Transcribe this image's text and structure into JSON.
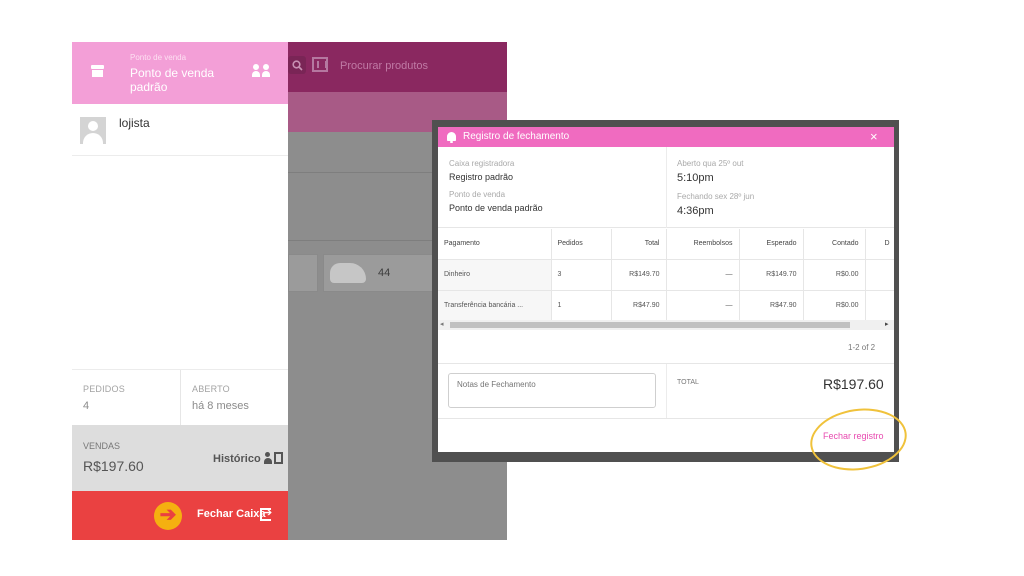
{
  "app": {
    "search_placeholder": "Procurar produtos",
    "product_size": "44"
  },
  "sidebar": {
    "pos_label": "Ponto de venda",
    "pos_name": "Ponto de venda padrão",
    "user_name": "lojista",
    "stats": {
      "orders_label": "PEDIDOS",
      "orders_value": "4",
      "open_label": "ABERTO",
      "open_value": "há 8 meses"
    },
    "sales_label": "VENDAS",
    "sales_value": "R$197.60",
    "history_label": "Histórico",
    "close_cash_label": "Fechar Caixa",
    "header_color": "#f39fd7",
    "close_color": "#ea4141"
  },
  "modal": {
    "title": "Registro de fechamento",
    "close_symbol": "×",
    "register_label": "Caixa registradora",
    "register_value": "Registro padrão",
    "pos_label": "Ponto de venda",
    "pos_value": "Ponto de venda padrão",
    "opened_label": "Aberto qua 25º out",
    "opened_time": "5:10pm",
    "closed_label": "Fechando sex 28º jun",
    "closed_time": "4:36pm",
    "table": {
      "headers": [
        "Pagamento",
        "Pedidos",
        "Total",
        "Reembolsos",
        "Esperado",
        "Contado",
        "D"
      ],
      "rows": [
        [
          "Dinheiro",
          "3",
          "R$149.70",
          "—",
          "R$149.70",
          "R$0.00",
          ""
        ],
        [
          "Transferência bancária ...",
          "1",
          "R$47.90",
          "—",
          "R$47.90",
          "R$0.00",
          ""
        ]
      ]
    },
    "pagination": "1-2 of 2",
    "notes_placeholder": "Notas de Fechamento",
    "total_label": "TOTAL",
    "total_value": "R$197.60",
    "close_register_label": "Fechar registro",
    "accent_color": "#f06bc0",
    "highlight_color": "#f0c23b"
  }
}
